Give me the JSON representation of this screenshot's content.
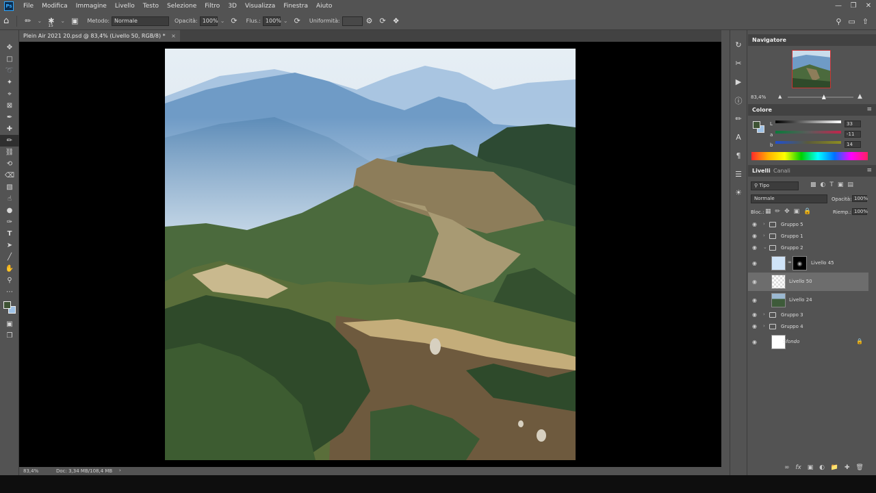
{
  "app": {
    "logo": "Ps"
  },
  "menu": [
    "File",
    "Modifica",
    "Immagine",
    "Livello",
    "Testo",
    "Selezione",
    "Filtro",
    "3D",
    "Visualizza",
    "Finestra",
    "Aiuto"
  ],
  "options": {
    "brush_size": "15",
    "mode_label": "Metodo:",
    "mode_value": "Normale",
    "opacity_label": "Opacità:",
    "opacity_value": "100%",
    "flow_label": "Flus.:",
    "flow_value": "100%",
    "smoothing_label": "Uniformità:"
  },
  "document": {
    "tab_title": "Plein Air 2021 20.psd @ 83,4% (Livello 50, RGB/8) *",
    "close": "×"
  },
  "status": {
    "zoom": "83,4%",
    "doc_info": "Doc: 3,34 MB/108,4 MB",
    "arrow": "›"
  },
  "navigator": {
    "title": "Navigatore",
    "zoom": "83,4%",
    "zoom_level": 0.55
  },
  "color": {
    "title": "Colore",
    "L_label": "L",
    "L_value": "33",
    "a_label": "a",
    "a_value": "-11",
    "b_label": "b",
    "b_value": "14",
    "fg": "#3e5334",
    "bg": "#9fc2e6"
  },
  "layers_panel": {
    "tab_layers": "Livelli",
    "tab_channels": "Canali",
    "filter": "Tipo",
    "blend_mode": "Normale",
    "opacity_label": "Opacità:",
    "opacity_value": "100%",
    "lock_label": "Bloc.:",
    "fill_label": "Riemp.:",
    "fill_value": "100%",
    "layers": [
      {
        "name": "Gruppo 5"
      },
      {
        "name": "Gruppo 1"
      },
      {
        "name": "Gruppo 2"
      },
      {
        "name": "Livello 45"
      },
      {
        "name": "Livello 50"
      },
      {
        "name": "Livello 24"
      },
      {
        "name": "Gruppo 3"
      },
      {
        "name": "Gruppo 4"
      },
      {
        "name": "Sfondo"
      }
    ]
  }
}
